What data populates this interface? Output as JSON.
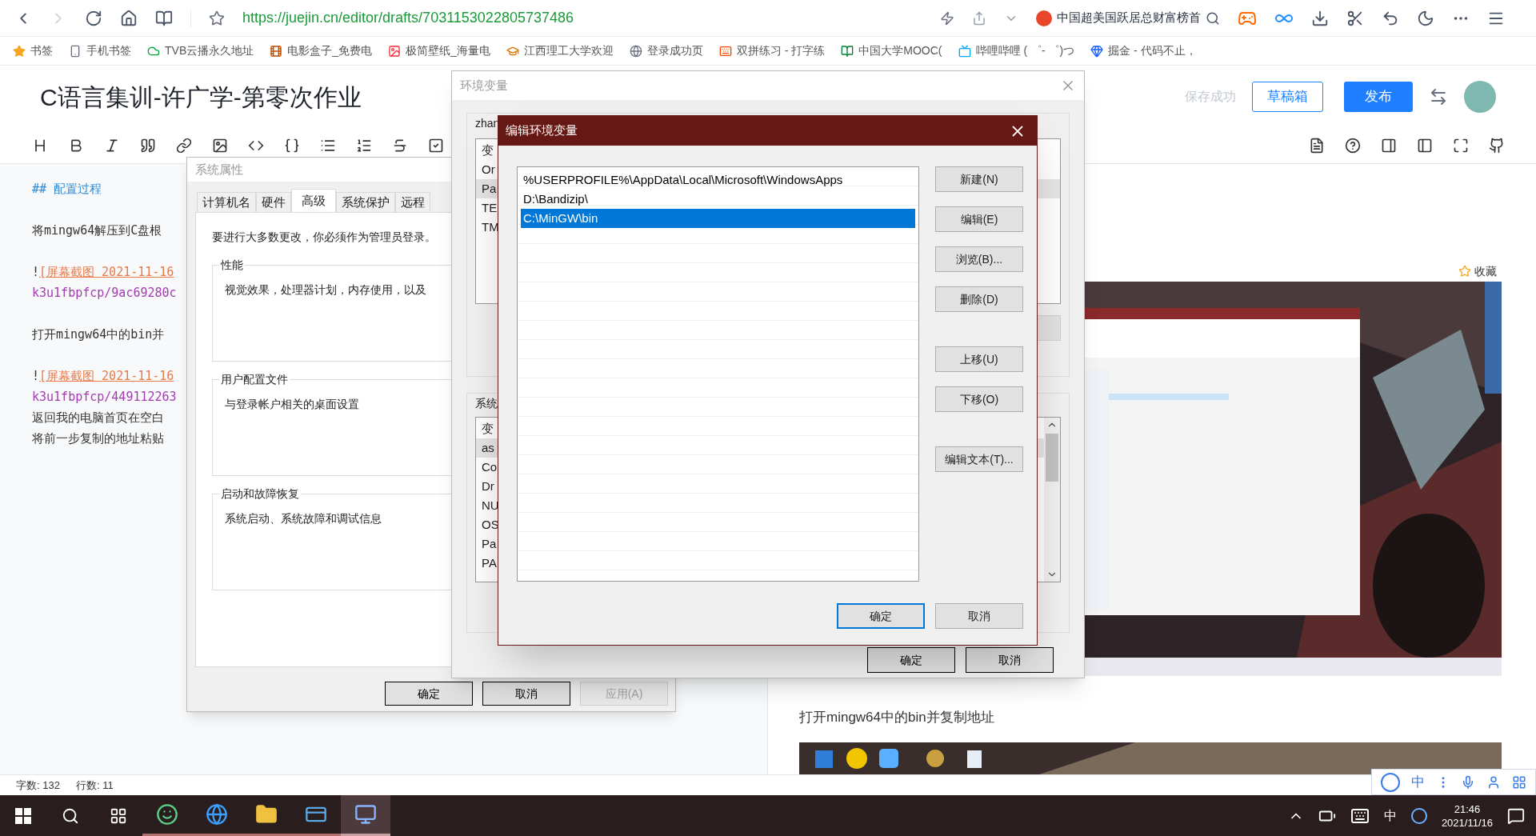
{
  "browser": {
    "url": "https://juejin.cn/editor/drafts/7031153022805737486",
    "search_text": "中国超美国跃居总财富榜首"
  },
  "bookmarks": [
    "书签",
    "手机书签",
    "TVB云播永久地址",
    "电影盒子_免费电",
    "极简壁纸_海量电",
    "江西理工大学欢迎",
    "登录成功页",
    "双拼练习 - 打字练",
    "中国大学MOOC(",
    "哔哩哔哩 ( ゜- ゜)つ",
    "掘金 - 代码不止，"
  ],
  "editor": {
    "title": "C语言集训-许广学-第零次作业",
    "save_status": "保存成功",
    "drafts_button": "草稿箱",
    "publish_button": "发布",
    "paragraphs": [
      [
        {
          "kind": "heading",
          "text": "## 配置过程"
        }
      ],
      [
        {
          "kind": "text",
          "text": "将mingw64解压到C盘根"
        }
      ],
      [
        {
          "kind": "image_link",
          "bang": "!",
          "text": "[屏幕截图 2021-11-16"
        },
        {
          "kind": "url",
          "text": "k3u1fbpfcp/9ac69280c"
        }
      ],
      [
        {
          "kind": "text",
          "text": "打开mingw64中的bin并"
        }
      ],
      [
        {
          "kind": "image_link",
          "bang": "!",
          "text": "[屏幕截图 2021-11-16"
        },
        {
          "kind": "url",
          "text": "k3u1fbpfcp/449112263"
        },
        {
          "kind": "text",
          "text": "返回我的电脑首页在空白"
        },
        {
          "kind": "text",
          "text": "将前一步复制的地址粘贴"
        }
      ]
    ]
  },
  "preview": {
    "favorite_button": "收藏",
    "paragraph": "打开mingw64中的bin并复制地址"
  },
  "status_bar": {
    "words": "字数: 132",
    "lines": "行数: 11"
  },
  "system_properties": {
    "title": "系统属性",
    "tabs": [
      {
        "label": "计算机名",
        "selected": false
      },
      {
        "label": "硬件",
        "selected": false
      },
      {
        "label": "高级",
        "selected": true
      },
      {
        "label": "系统保护",
        "selected": false
      },
      {
        "label": "远程",
        "selected": false
      }
    ],
    "notice": "要进行大多数更改，你必须作为管理员登录。",
    "groups": [
      {
        "title": "性能",
        "text": "视觉效果，处理器计划，内存使用，以及"
      },
      {
        "title": "用户配置文件",
        "text": "与登录帐户相关的桌面设置"
      },
      {
        "title": "启动和故障恢复",
        "text": "系统启动、系统故障和调试信息"
      }
    ],
    "buttons": [
      {
        "label": "确定",
        "disabled": false
      },
      {
        "label": "取消",
        "disabled": false
      },
      {
        "label": "应用(A)",
        "disabled": true
      }
    ]
  },
  "environment_variables": {
    "title": "环境变量",
    "user_label": "zhan",
    "user_rows": [
      {
        "text": "变",
        "selected": false
      },
      {
        "text": "Or",
        "selected": false
      },
      {
        "text": "Pa",
        "selected": true
      },
      {
        "text": "TE",
        "selected": false
      },
      {
        "text": "TM",
        "selected": false
      }
    ],
    "system_label": "系统",
    "system_rows": [
      {
        "text": "变",
        "selected": false
      },
      {
        "text": "as",
        "selected": true
      },
      {
        "text": "Co",
        "selected": false
      },
      {
        "text": "Dr",
        "selected": false
      },
      {
        "text": "NU",
        "selected": false
      },
      {
        "text": "OS",
        "selected": false
      },
      {
        "text": "Pa",
        "selected": false
      },
      {
        "text": "PA",
        "selected": false
      }
    ],
    "buttons": [
      "确定",
      "取消"
    ]
  },
  "edit_dialog": {
    "title": "编辑环境变量",
    "entries": [
      {
        "text": "%USERPROFILE%\\AppData\\Local\\Microsoft\\WindowsApps",
        "selected": false
      },
      {
        "text": "D:\\Bandizip\\",
        "selected": false
      },
      {
        "text": "C:\\MinGW\\bin",
        "selected": true
      }
    ],
    "side_button_groups": [
      [
        "新建(N)",
        "编辑(E)",
        "浏览(B)...",
        "删除(D)"
      ],
      [
        "上移(U)",
        "下移(O)"
      ],
      [
        "编辑文本(T)..."
      ]
    ],
    "buttons": [
      {
        "label": "确定",
        "focused": true
      },
      {
        "label": "取消",
        "focused": false
      }
    ]
  },
  "ime_toolbar": {
    "mode": "中"
  },
  "taskbar": {
    "apps": [
      {
        "kind": "chat",
        "selected": false
      },
      {
        "kind": "browser",
        "selected": false
      },
      {
        "kind": "folder",
        "selected": false
      },
      {
        "kind": "card",
        "selected": false
      },
      {
        "kind": "monitor",
        "selected": true
      }
    ],
    "input_mode": "中",
    "time": "21:46",
    "date": "2021/11/16"
  }
}
